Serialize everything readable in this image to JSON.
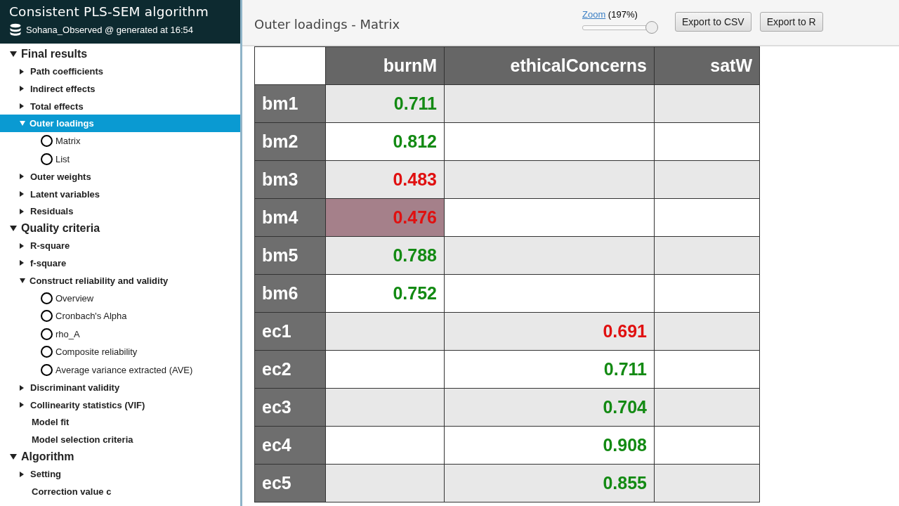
{
  "sidebar": {
    "title": "Consistent PLS-SEM algorithm",
    "subtitle": "Sohana_Observed @ generated at 16:54",
    "tree": [
      {
        "label": "Final results",
        "kind": "group",
        "expanded": true,
        "selected": false,
        "children": [
          {
            "label": "Path coefficients",
            "kind": "branch",
            "expanded": false,
            "selected": false
          },
          {
            "label": "Indirect effects",
            "kind": "branch",
            "expanded": false,
            "selected": false
          },
          {
            "label": "Total effects",
            "kind": "branch",
            "expanded": false,
            "selected": false
          },
          {
            "label": "Outer loadings",
            "kind": "branch",
            "expanded": true,
            "selected": true,
            "children": [
              {
                "label": "Matrix",
                "kind": "option",
                "selected": false
              },
              {
                "label": "List",
                "kind": "option",
                "selected": false
              }
            ]
          },
          {
            "label": "Outer weights",
            "kind": "branch",
            "expanded": false,
            "selected": false
          },
          {
            "label": "Latent variables",
            "kind": "branch",
            "expanded": false,
            "selected": false
          },
          {
            "label": "Residuals",
            "kind": "branch",
            "expanded": false,
            "selected": false
          }
        ]
      },
      {
        "label": "Quality criteria",
        "kind": "group",
        "expanded": true,
        "selected": false,
        "children": [
          {
            "label": "R-square",
            "kind": "branch",
            "expanded": false,
            "selected": false
          },
          {
            "label": "f-square",
            "kind": "branch",
            "expanded": false,
            "selected": false
          },
          {
            "label": "Construct reliability and validity",
            "kind": "branch",
            "expanded": true,
            "selected": false,
            "children": [
              {
                "label": "Overview",
                "kind": "option",
                "selected": false
              },
              {
                "label": "Cronbach's Alpha",
                "kind": "option",
                "selected": false
              },
              {
                "label": "rho_A",
                "kind": "option",
                "selected": false
              },
              {
                "label": "Composite reliability",
                "kind": "option",
                "selected": false
              },
              {
                "label": "Average variance extracted (AVE)",
                "kind": "option",
                "selected": false
              }
            ]
          },
          {
            "label": "Discriminant validity",
            "kind": "branch",
            "expanded": false,
            "selected": false
          },
          {
            "label": "Collinearity statistics (VIF)",
            "kind": "branch",
            "expanded": false,
            "selected": false
          },
          {
            "label": "Model fit",
            "kind": "leaf",
            "selected": false
          },
          {
            "label": "Model selection criteria",
            "kind": "leaf",
            "selected": false
          }
        ]
      },
      {
        "label": "Algorithm",
        "kind": "group",
        "expanded": true,
        "selected": false,
        "children": [
          {
            "label": "Setting",
            "kind": "branch",
            "expanded": false,
            "selected": false
          },
          {
            "label": "Correction value c",
            "kind": "leaf",
            "selected": false
          }
        ]
      }
    ]
  },
  "main": {
    "title": "Outer loadings - Matrix",
    "zoom": {
      "link": "Zoom",
      "reading": "(197%)",
      "level": 1
    },
    "buttons": [
      "Export to CSV",
      "Export to R"
    ],
    "table": {
      "columns": [
        "burnM",
        "ethicalConcerns",
        "satW"
      ],
      "rows": [
        {
          "label": "bm1",
          "cells": [
            {
              "value": "0.711",
              "color": "#138a13",
              "selected": false
            },
            null,
            null
          ]
        },
        {
          "label": "bm2",
          "cells": [
            {
              "value": "0.812",
              "color": "#138a13",
              "selected": false
            },
            null,
            null
          ]
        },
        {
          "label": "bm3",
          "cells": [
            {
              "value": "0.483",
              "color": "#e01010",
              "selected": false
            },
            null,
            null
          ]
        },
        {
          "label": "bm4",
          "cells": [
            {
              "value": "0.476",
              "color": "#e01010",
              "selected": true
            },
            null,
            null
          ]
        },
        {
          "label": "bm5",
          "cells": [
            {
              "value": "0.788",
              "color": "#138a13",
              "selected": false
            },
            null,
            null
          ]
        },
        {
          "label": "bm6",
          "cells": [
            {
              "value": "0.752",
              "color": "#138a13",
              "selected": false
            },
            null,
            null
          ]
        },
        {
          "label": "ec1",
          "cells": [
            null,
            {
              "value": "0.691",
              "color": "#e01010",
              "selected": false
            },
            null
          ]
        },
        {
          "label": "ec2",
          "cells": [
            null,
            {
              "value": "0.711",
              "color": "#138a13",
              "selected": false
            },
            null
          ]
        },
        {
          "label": "ec3",
          "cells": [
            null,
            {
              "value": "0.704",
              "color": "#138a13",
              "selected": false
            },
            null
          ]
        },
        {
          "label": "ec4",
          "cells": [
            null,
            {
              "value": "0.908",
              "color": "#138a13",
              "selected": false
            },
            null
          ]
        },
        {
          "label": "ec5",
          "cells": [
            null,
            {
              "value": "0.855",
              "color": "#138a13",
              "selected": false
            },
            null
          ]
        }
      ]
    }
  }
}
